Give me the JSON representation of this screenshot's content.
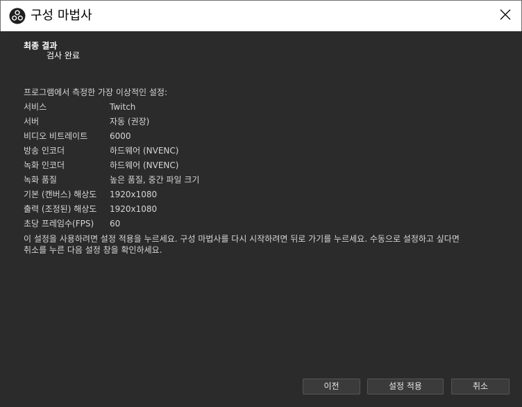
{
  "window": {
    "title": "구성 마법사",
    "close_label": "Close"
  },
  "result": {
    "heading": "최종 결과",
    "subheading": "검사 완료",
    "intro": "프로그램에서 측정한 가장 이상적인 설정:"
  },
  "settings": [
    {
      "key": "서비스",
      "value": "Twitch"
    },
    {
      "key": "서버",
      "value": "자동 (권장)"
    },
    {
      "key": "비디오 비트레이트",
      "value": "6000"
    },
    {
      "key": "방송 인코더",
      "value": "하드웨어 (NVENC)"
    },
    {
      "key": "녹화 인코더",
      "value": "하드웨어 (NVENC)"
    },
    {
      "key": "녹화 품질",
      "value": "높은 품질, 중간 파일 크기"
    },
    {
      "key": "기본 (캔버스) 해상도",
      "value": "1920x1080"
    },
    {
      "key": "출력 (조정된) 해상도",
      "value": "1920x1080"
    },
    {
      "key": "초당 프레임수(FPS)",
      "value": "60"
    }
  ],
  "note": {
    "line1": "이 설정을 사용하려면 설정 적용을 누르세요. 구성 마법사를 다시 시작하려면 뒤로 가기를 누르세요. 수동으로 설정하고 싶다면",
    "line2": "취소를 누른 다음 설정 창을 확인하세요."
  },
  "buttons": {
    "back": "이전",
    "apply": "설정 적용",
    "cancel": "취소"
  },
  "icons": {
    "app": "obs-logo-icon",
    "close": "close-icon"
  },
  "colors": {
    "background": "#2b2b2b",
    "titlebar": "#ffffff",
    "text": "#d6d6d6",
    "button": "#3b3b3b"
  }
}
